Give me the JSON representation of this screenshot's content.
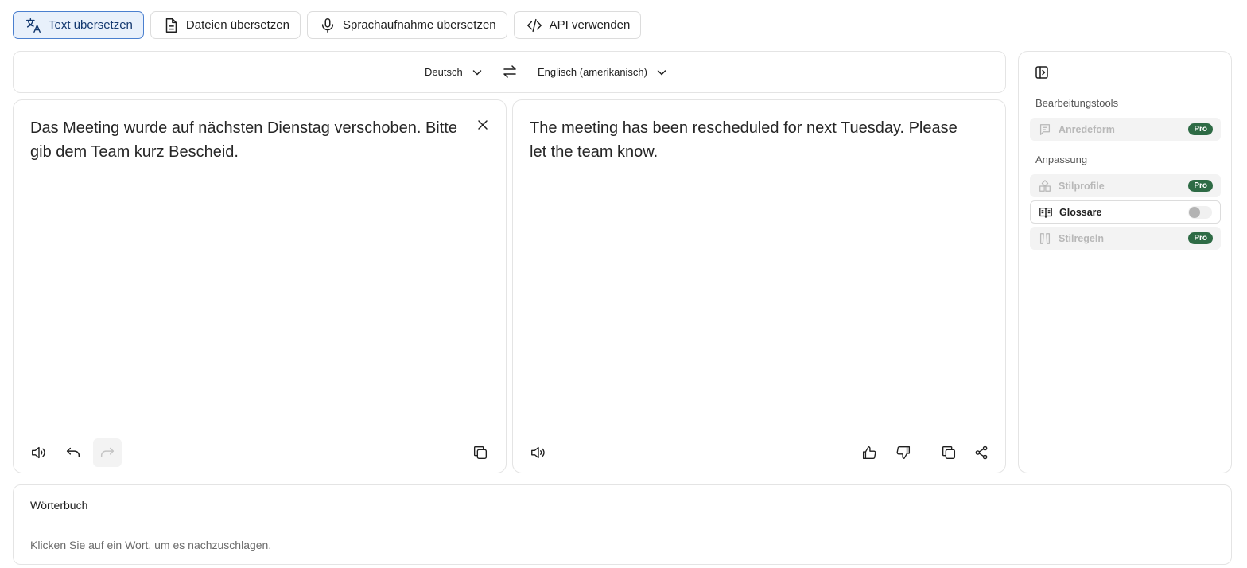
{
  "tabs": [
    {
      "label": "Text übersetzen",
      "icon": "translate-icon",
      "active": true
    },
    {
      "label": "Dateien übersetzen",
      "icon": "document-icon",
      "active": false
    },
    {
      "label": "Sprachaufnahme übersetzen",
      "icon": "microphone-icon",
      "active": false
    },
    {
      "label": "API verwenden",
      "icon": "code-icon",
      "active": false
    }
  ],
  "languages": {
    "source": "Deutsch",
    "target": "Englisch (amerikanisch)"
  },
  "source_panel": {
    "text": "Das Meeting wurde auf nächsten Dienstag verschoben. Bitte gib dem Team kurz Bescheid."
  },
  "target_panel": {
    "text": "The meeting has been rescheduled for next Tuesday. Please let the team know."
  },
  "side_panel": {
    "editing_label": "Bearbeitungstools",
    "customization_label": "Anpassung",
    "tools": {
      "anredeform": {
        "label": "Anredeform",
        "badge": "Pro"
      },
      "stilprofile": {
        "label": "Stilprofile",
        "badge": "Pro"
      },
      "glossare": {
        "label": "Glossare",
        "enabled": false
      },
      "stilregeln": {
        "label": "Stilregeln",
        "badge": "Pro"
      }
    }
  },
  "dictionary": {
    "title": "Wörterbuch",
    "hint": "Klicken Sie auf ein Wort, um es nachzuschlagen."
  },
  "colors": {
    "active_tab_bg": "#e8f0fb",
    "active_tab_border": "#4a7fcf",
    "pro_badge": "#2e6b45"
  }
}
